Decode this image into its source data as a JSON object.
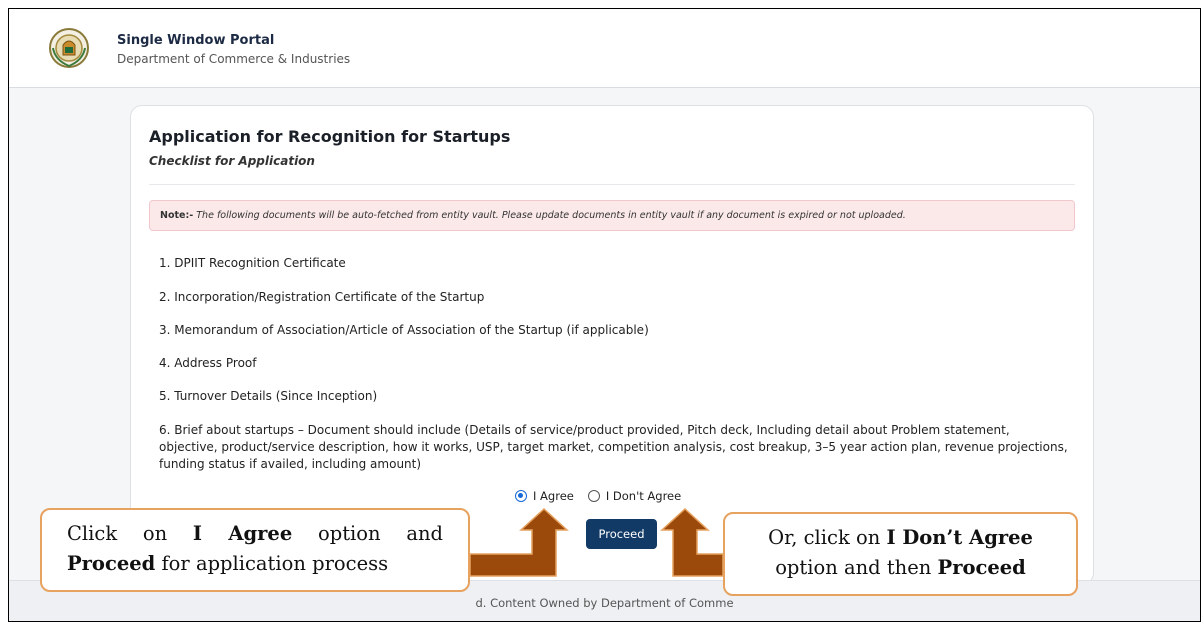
{
  "header": {
    "title": "Single Window Portal",
    "subtitle": "Department of Commerce & Industries",
    "logo_icon": "state-emblem-icon"
  },
  "card": {
    "title": "Application for Recognition for Startups",
    "subtitle": "Checklist for Application",
    "note": {
      "label": "Note:-",
      "text": "The following documents will be auto-fetched from entity vault. Please update documents in entity vault if any document is expired or not uploaded."
    },
    "items": [
      "1. DPIIT Recognition Certificate",
      "2. Incorporation/Registration Certificate of the Startup",
      "3. Memorandum of Association/Article of Association of the Startup (if applicable)",
      "4. Address Proof",
      "5. Turnover Details (Since Inception)",
      "6. Brief about startups – Document should include (Details of service/product provided, Pitch deck, Including detail about Problem statement, objective, product/service description, how it works, USP, target market, competition analysis, cost breakup, 3–5 year action plan, revenue projections, funding status if availed, including amount)"
    ],
    "agree_option": "I Agree",
    "disagree_option": "I Don't Agree",
    "selected_option": "I Agree",
    "proceed_label": "Proceed"
  },
  "footer": {
    "text": "d. Content Owned by Department of Comme"
  },
  "callouts": {
    "left": {
      "prefix": "Click on ",
      "bold1": "I Agree",
      "middle": " option and",
      "bold2": "Proceed",
      "suffix": " for application process"
    },
    "right": {
      "prefix": "Or, click on ",
      "bold1": "I Don’t Agree",
      "middle": "option and then ",
      "bold2": "Proceed"
    }
  },
  "colors": {
    "accent": "#123a66",
    "radio_selected": "#1668d8",
    "note_bg": "#fbe9ea",
    "arrow": "#9c4a0c",
    "callout_border": "#e6a25e"
  }
}
